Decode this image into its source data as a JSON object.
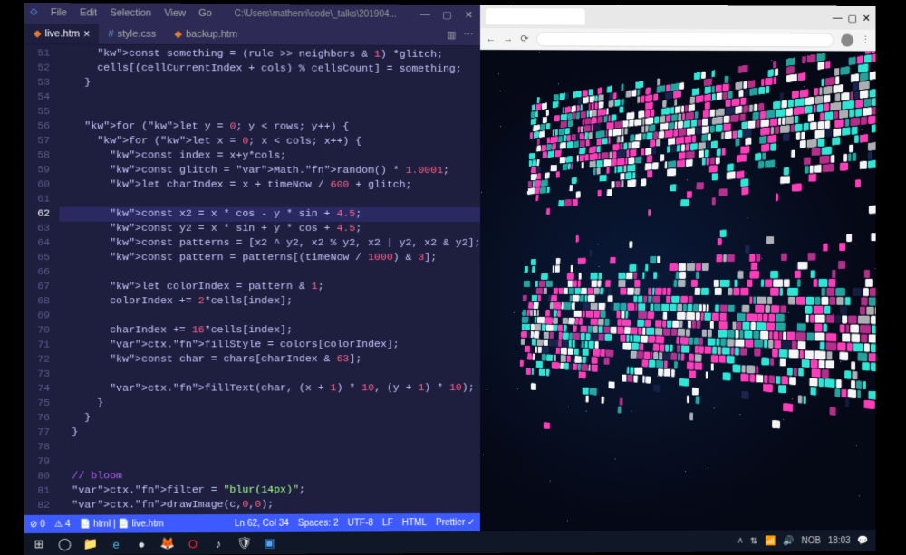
{
  "vscode": {
    "menu": [
      "File",
      "Edit",
      "Selection",
      "View",
      "Go"
    ],
    "path": "C:\\Users\\mathenri\\code\\_talks\\201904...",
    "tabs": [
      {
        "label": "live.htm",
        "active": true,
        "close": "×"
      },
      {
        "label": "style.css",
        "active": false,
        "close": ""
      },
      {
        "label": "backup.htm",
        "active": false,
        "close": ""
      }
    ],
    "tab_actions": {
      "split": "▥",
      "more": "⋯"
    },
    "winctl": {
      "min": "—",
      "max": "▢",
      "close": "✕"
    },
    "first_line_no": 51,
    "current_line": 62,
    "code_lines": [
      "      const something = (rule >> neighbors & 1) *glitch;",
      "      cells[(cellCurrentIndex + cols) % cellsCount] = something;",
      "    }",
      "",
      "",
      "    for (let y = 0; y < rows; y++) {",
      "      for (let x = 0; x < cols; x++) {",
      "        const index = x+y*cols;",
      "        const glitch = Math.random() * 1.0001;",
      "        let charIndex = x + timeNow / 600 + glitch;",
      "",
      "        const x2 = x * cos - y * sin + 4.5;",
      "        const y2 = x * sin + y * cos + 4.5;",
      "        const patterns = [x2 ^ y2, x2 % y2, x2 | y2, x2 & y2];",
      "        const pattern = patterns[(timeNow / 1000) & 3];",
      "",
      "        let colorIndex = pattern & 1;",
      "        colorIndex += 2*cells[index];",
      "",
      "        charIndex += 16*cells[index];",
      "        ctx.fillStyle = colors[colorIndex];",
      "        const char = chars[charIndex & 63];",
      "",
      "        ctx.fillText(char, (x + 1) * 10, (y + 1) * 10);",
      "      }",
      "    }",
      "  }",
      "",
      "",
      "  // bloom",
      "  ctx.filter = \"blur(14px)\";",
      "  ctx.drawImage(c,0,0);"
    ],
    "statusbar": {
      "errors": "⊘ 0",
      "warnings": "⚠ 4",
      "branch": "html",
      "file": "live.htm",
      "cursor": "Ln 62, Col 34",
      "spaces": "Spaces: 2",
      "encoding": "UTF-8",
      "eol": "LF",
      "lang": "HTML",
      "prettier": "Prettier ✓"
    }
  },
  "browser": {
    "winctl": {
      "min": "—",
      "max": "▢",
      "close": "✕"
    }
  },
  "taskbar": {
    "icons": [
      "⊞",
      "◯",
      "📁",
      "e",
      "●",
      "🦊",
      "O",
      "♪",
      "🛡",
      "▣",
      "⬛",
      "⬛",
      "⬛"
    ],
    "tray": {
      "up": "˄",
      "net": "⇅",
      "wifi": "📶",
      "vol": "🔊",
      "lang": "NOB",
      "time": "18:03",
      "notif": "💬"
    }
  },
  "colors": {
    "magenta": "#ff3dbb",
    "cyan": "#2ee6d6",
    "white": "#f5f5f5",
    "dark": "#1a2550"
  }
}
